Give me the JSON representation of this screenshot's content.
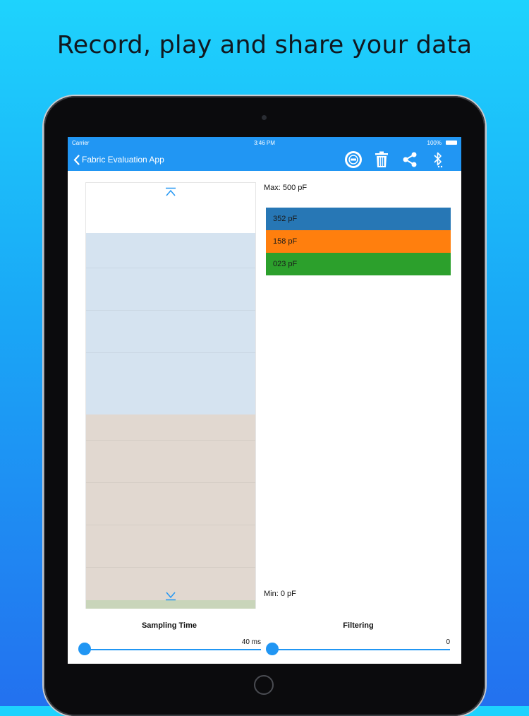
{
  "headline": "Record, play and share your data",
  "statusbar": {
    "carrier": "Carrier",
    "time": "3:46 PM",
    "battery": "100%"
  },
  "navbar": {
    "back_label": "Fabric Evaluation App"
  },
  "icons": {
    "back": "chevron-left-icon",
    "record": "record-icon",
    "delete": "trash-icon",
    "share": "share-icon",
    "bluetooth": "bluetooth-icon"
  },
  "display": {
    "max_label": "Max: 500 pF",
    "min_label": "Min: 0 pF",
    "max_value": 500,
    "min_value": 0
  },
  "readings": [
    {
      "label": "352 pF",
      "value": 352,
      "color": "#2777b5",
      "fill": "#d5e3f0"
    },
    {
      "label": "158 pF",
      "value": 158,
      "color": "#ff7f0e",
      "fill": "#e1d8d0"
    },
    {
      "label": "023 pF",
      "value": 23,
      "color": "#2ca02c",
      "fill": "#c9d5ba"
    }
  ],
  "controls": {
    "sampling": {
      "title": "Sampling Time",
      "value_label": "40 ms",
      "position": 0
    },
    "filtering": {
      "title": "Filtering",
      "value_label": "0",
      "position": 0
    }
  },
  "colors": {
    "accent": "#2196f3"
  }
}
